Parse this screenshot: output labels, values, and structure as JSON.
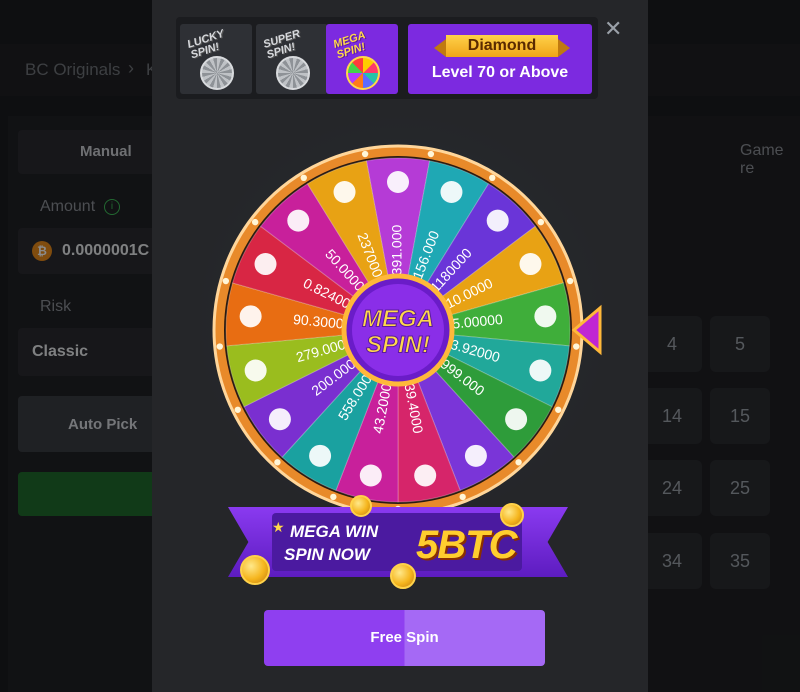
{
  "background": {
    "breadcrumb": "BC Originals",
    "breadcrumb_tail": "K",
    "tab_manual": "Manual",
    "tab_game": "Game re",
    "amount_label": "Amount",
    "amount_value": "0.0000001C",
    "risk_label": "Risk",
    "risk_value": "Classic",
    "auto_pick": "Auto Pick",
    "tiles": [
      "4",
      "5",
      "14",
      "15",
      "24",
      "25",
      "34",
      "35"
    ]
  },
  "modal": {
    "close_icon": "close-icon",
    "spin_cards": [
      {
        "label": "LUCKY SPIN!",
        "active": false
      },
      {
        "label": "SUPER SPIN!",
        "active": false
      },
      {
        "label": "MEGA SPIN!",
        "active": true
      }
    ],
    "tier": {
      "name": "Diamond",
      "level": "Level 70 or Above"
    },
    "wheel": {
      "center_line1": "MEGA",
      "center_line2": "SPIN!",
      "segments": [
        {
          "value": "391.000",
          "icon": "tron-icon",
          "color": "#b53bd6"
        },
        {
          "value": "156.000",
          "icon": "triangle-token-icon",
          "color": "#1fa8b4"
        },
        {
          "value": "1180000",
          "icon": "shiba-icon",
          "color": "#6a35d8"
        },
        {
          "value": "10.0000",
          "icon": "refresh-token-icon",
          "color": "#e8a214"
        },
        {
          "value": "5.00000",
          "icon": "bitcoin-icon",
          "color": "#3fae3a"
        },
        {
          "value": "3.92000",
          "icon": "",
          "color": "#21a89a"
        },
        {
          "value": "999.000",
          "icon": "bnb-icon",
          "color": "#2e9c3a"
        },
        {
          "value": "",
          "icon": "refresh-token-icon",
          "color": "#7a35d8"
        },
        {
          "value": "39.4000",
          "icon": "gift-icon",
          "color": "#d6256a"
        },
        {
          "value": "43.2000",
          "icon": "sei-icon",
          "color": "#c8209b"
        },
        {
          "value": "558.000",
          "icon": "x-token-icon",
          "color": "#1aa1a0"
        },
        {
          "value": "200.000",
          "icon": "refresh-token-icon",
          "color": "#7a2fd0"
        },
        {
          "value": "279.000",
          "icon": "xrp-icon",
          "color": "#9abd1e"
        },
        {
          "value": "90.3000",
          "icon": "puzzle-token-icon",
          "color": "#e86d12"
        },
        {
          "value": "0.82400",
          "icon": "lion-token-icon",
          "color": "#d82644"
        },
        {
          "value": "50.0000",
          "icon": "refresh-token-icon",
          "color": "#c8209b"
        },
        {
          "value": "237000",
          "icon": "stellar-icon",
          "color": "#e8a214"
        }
      ]
    },
    "promo": {
      "line1": "MEGA WIN",
      "line2": "SPIN NOW",
      "amount": "5BTC"
    },
    "free_spin": "Free Spin"
  }
}
